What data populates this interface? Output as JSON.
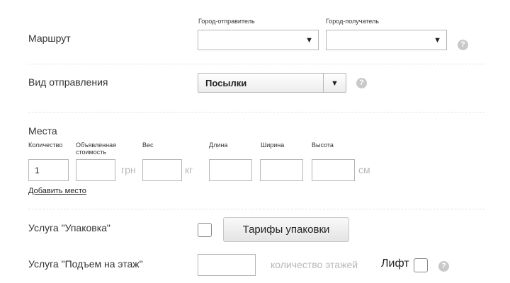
{
  "route": {
    "label": "Маршрут",
    "from_caption": "Город-отправитель",
    "to_caption": "Город-получатель",
    "from_value": "",
    "to_value": "",
    "help_icon": "question-icon"
  },
  "shipment": {
    "label": "Вид отправления",
    "selected": "Посылки",
    "help_icon": "question-icon"
  },
  "places": {
    "label": "Места",
    "columns": {
      "quantity": "Количество",
      "declared_value": "Объявленная стоимость",
      "weight": "Вес",
      "length": "Длина",
      "width": "Ширина",
      "height": "Высота"
    },
    "values": {
      "quantity": "1",
      "declared_value": "",
      "weight": "",
      "length": "",
      "width": "",
      "height": ""
    },
    "units": {
      "currency": "грн",
      "weight": "кг",
      "dimension": "см"
    },
    "add_link": "Добавить место"
  },
  "packing": {
    "label": "Услуга \"Упаковка\"",
    "tariffs_button": "Тарифы упаковки"
  },
  "lift_service": {
    "label": "Услуга \"Подъем на этаж\"",
    "floors_placeholder": "количество этажей",
    "lift_label": "Лифт",
    "help_icon": "question-icon"
  },
  "colors": {
    "text": "#333333",
    "muted": "#b8b8b8",
    "border": "#b5b5b5",
    "help": "#c9c9c9"
  }
}
